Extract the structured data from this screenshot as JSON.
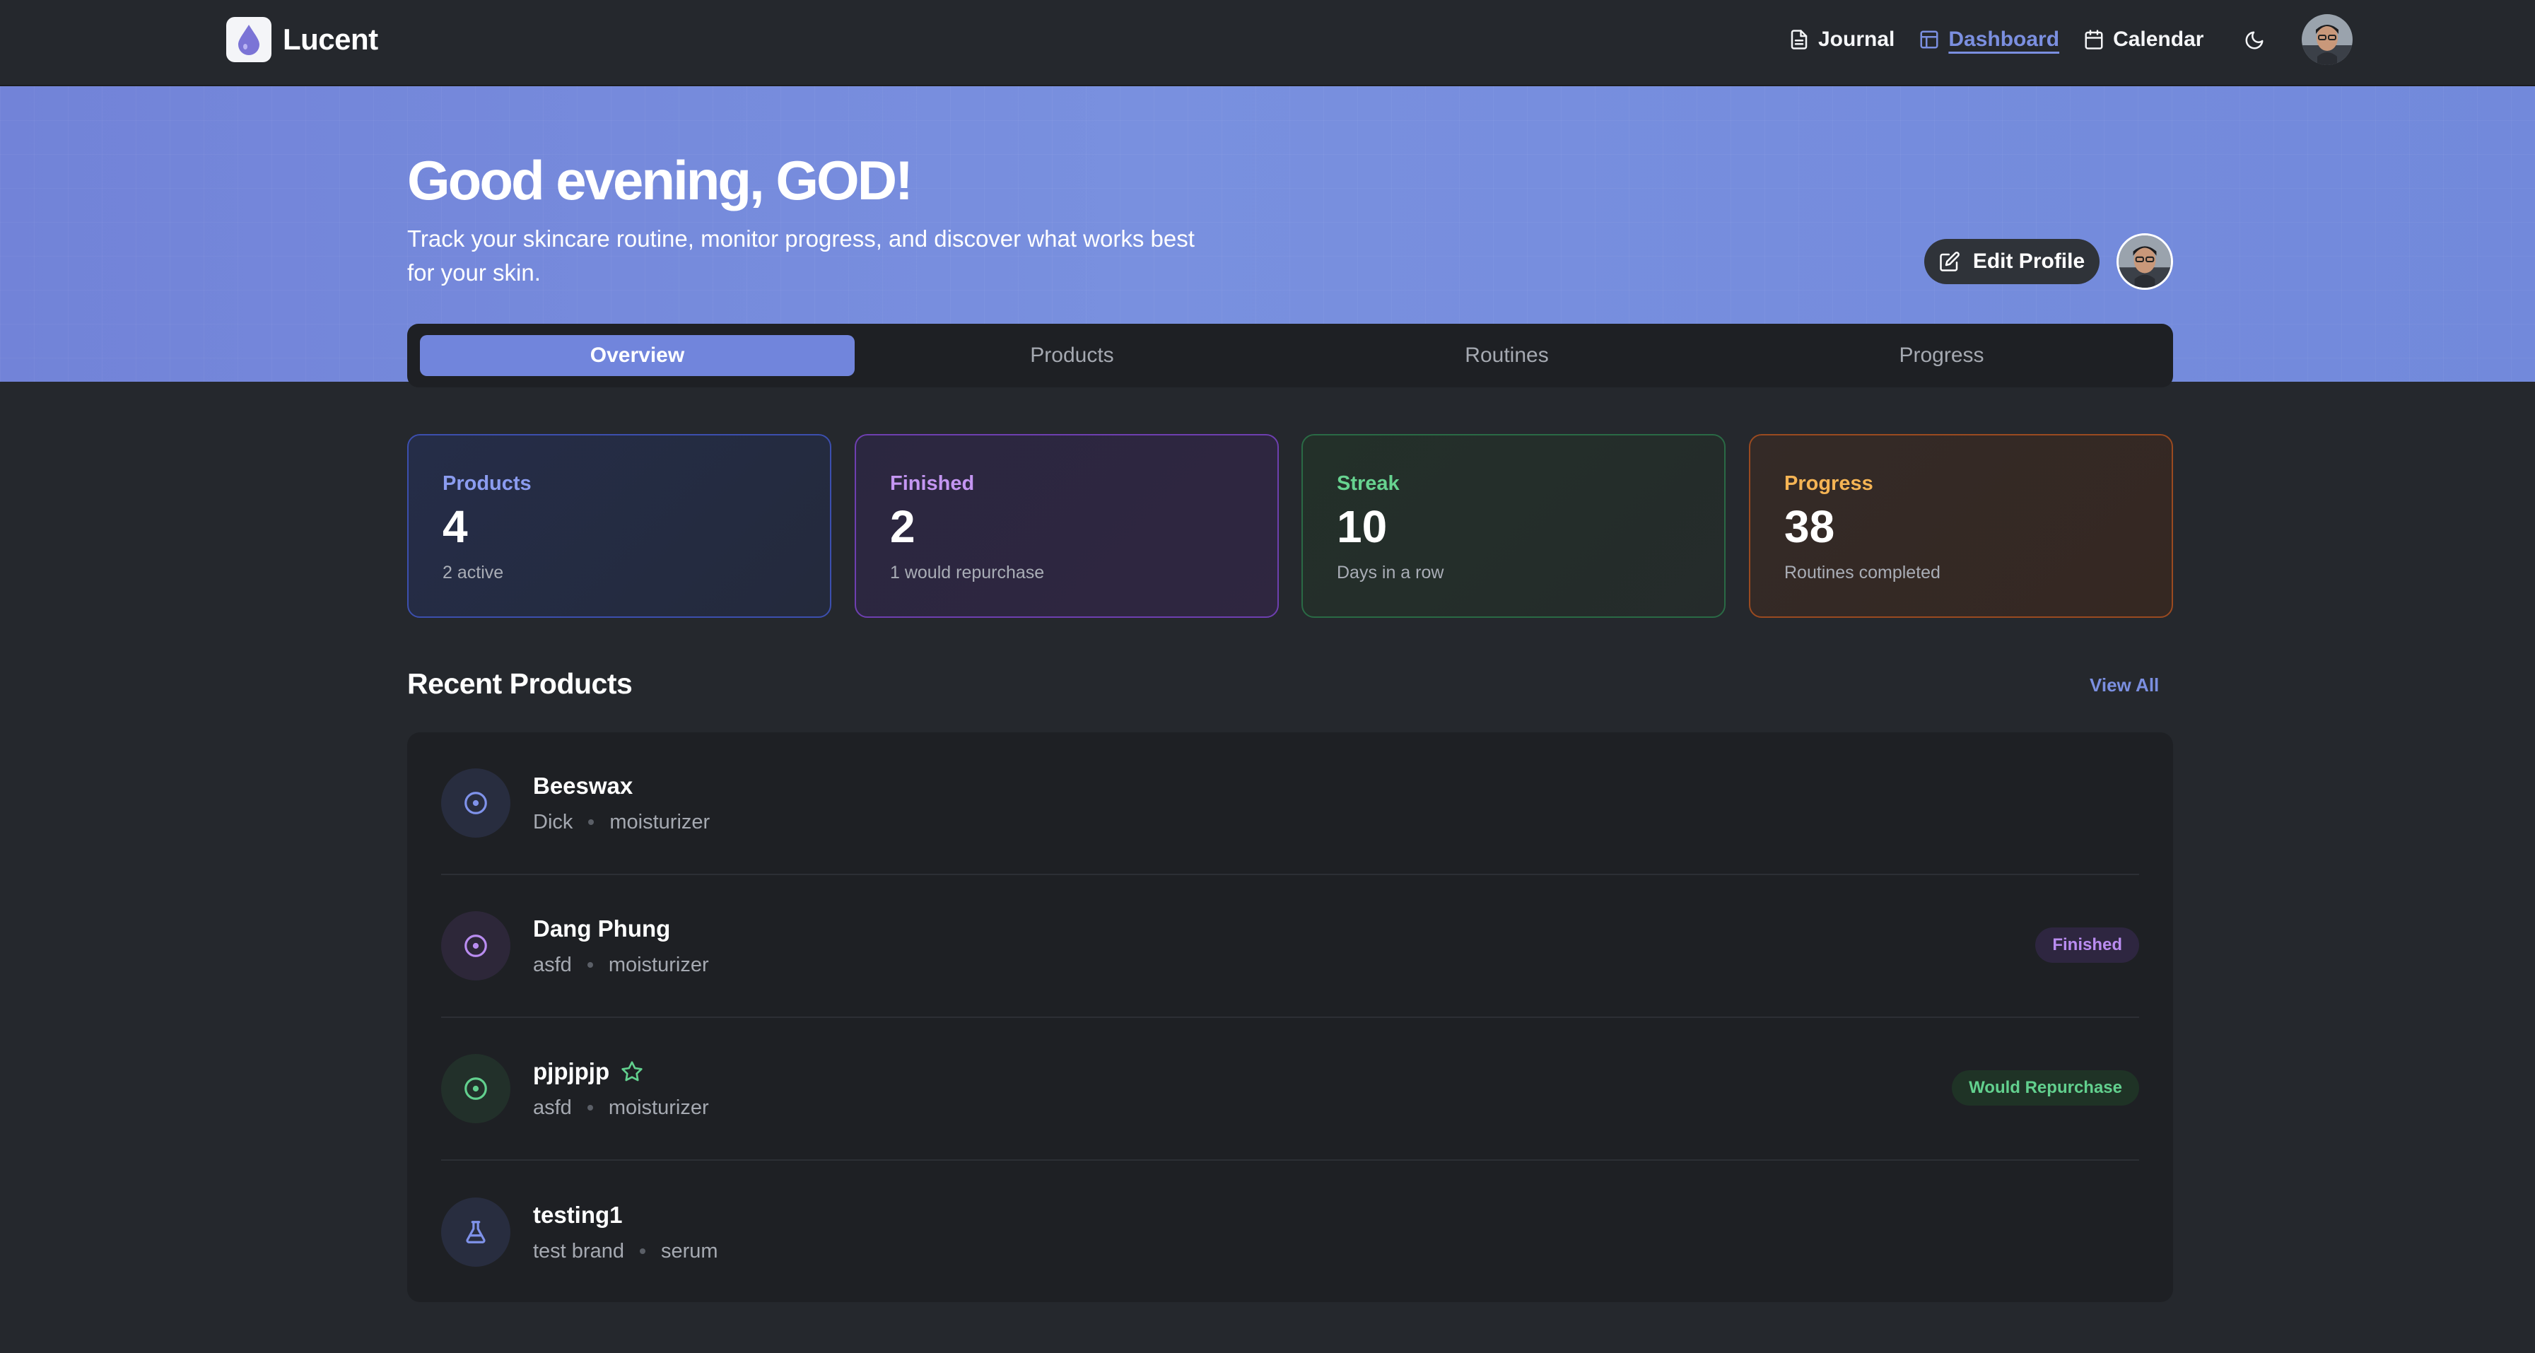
{
  "app": {
    "name": "Lucent"
  },
  "nav": {
    "items": [
      {
        "label": "Journal",
        "icon": "document-icon",
        "active": false
      },
      {
        "label": "Dashboard",
        "icon": "layout-icon",
        "active": true
      },
      {
        "label": "Calendar",
        "icon": "calendar-icon",
        "active": false
      }
    ],
    "theme_icon": "moon-icon"
  },
  "hero": {
    "greeting": "Good evening, GOD!",
    "subtitle": "Track your skincare routine, monitor progress, and discover what works best for your skin.",
    "edit_profile_label": "Edit Profile"
  },
  "tabs": [
    {
      "label": "Overview",
      "active": true
    },
    {
      "label": "Products",
      "active": false
    },
    {
      "label": "Routines",
      "active": false
    },
    {
      "label": "Progress",
      "active": false
    }
  ],
  "stats": [
    {
      "label": "Products",
      "value": "4",
      "note": "2 active",
      "color": "#8b9cf0"
    },
    {
      "label": "Finished",
      "value": "2",
      "note": "1 would repurchase",
      "color": "#c496f2"
    },
    {
      "label": "Streak",
      "value": "10",
      "note": "Days in a row",
      "color": "#67d390"
    },
    {
      "label": "Progress",
      "value": "38",
      "note": "Routines completed",
      "color": "#f5b454"
    }
  ],
  "recent_products": {
    "title": "Recent Products",
    "view_all_label": "View All",
    "items": [
      {
        "name": "Beeswax",
        "brand": "Dick",
        "category": "moisturizer",
        "icon": "target-icon",
        "badge": "",
        "starred": false
      },
      {
        "name": "Dang Phung",
        "brand": "asfd",
        "category": "moisturizer",
        "icon": "target-icon",
        "badge": "Finished",
        "starred": false
      },
      {
        "name": "pjpjpjp",
        "brand": "asfd",
        "category": "moisturizer",
        "icon": "target-icon",
        "badge": "Would Repurchase",
        "starred": true
      },
      {
        "name": "testing1",
        "brand": "test brand",
        "category": "serum",
        "icon": "flask-icon",
        "badge": "",
        "starred": false
      }
    ]
  },
  "colors": {
    "accent": "#7185dc",
    "background": "#25282d",
    "surface": "#1e2024"
  }
}
